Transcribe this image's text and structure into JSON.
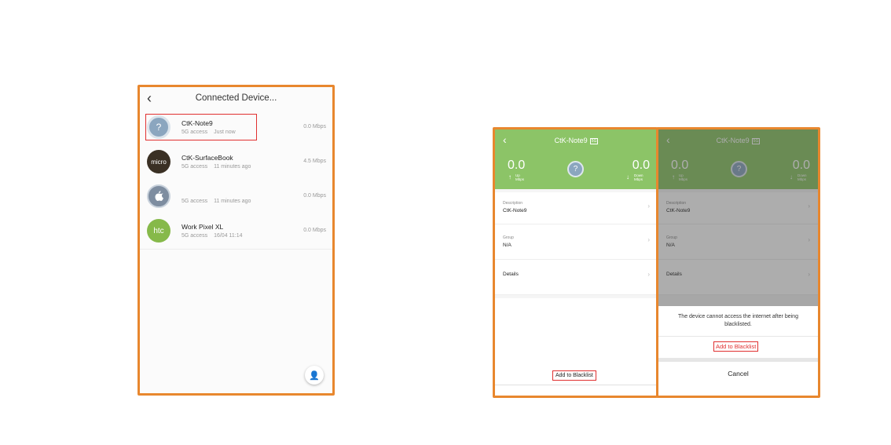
{
  "colors": {
    "frame": "#e8872e",
    "highlight": "#e03030",
    "header_green": "#8cc467"
  },
  "screen1": {
    "title": "Connected Device...",
    "devices": [
      {
        "name": "CtK-Note9",
        "band": "5G access",
        "time": "Just now",
        "speed": "0.0 Mbps",
        "avatar_icon": "question-mark-icon",
        "avatar_text": "?"
      },
      {
        "name": "CtK-SurfaceBook",
        "band": "5G access",
        "time": "11 minutes ago",
        "speed": "4.5 Mbps",
        "avatar_icon": "microsoft-logo-icon",
        "avatar_text": "micro"
      },
      {
        "name": "",
        "band": "5G access",
        "time": "11 minutes ago",
        "speed": "0.0 Mbps",
        "avatar_icon": "apple-logo-icon",
        "avatar_text": ""
      },
      {
        "name": "Work Pixel XL",
        "band": "5G access",
        "time": "16/04 11:14",
        "speed": "0.0 Mbps",
        "avatar_icon": "htc-logo-icon",
        "avatar_text": "htc"
      }
    ]
  },
  "detail": {
    "title": "CtK-Note9",
    "band_tag": "5G",
    "up_value": "0.0",
    "up_unit": "Up",
    "up_unit2": "Mbps",
    "down_value": "0.0",
    "down_unit": "Down",
    "down_unit2": "Mbps",
    "description_label": "Description",
    "description_value": "CtK-Note9",
    "group_label": "Group",
    "group_value": "N/A",
    "details_label": "Details",
    "blacklist_button": "Add to Blacklist"
  },
  "sheet": {
    "message": "The device cannot access the internet after being blacklisted.",
    "add_label": "Add to Blacklist",
    "cancel_label": "Cancel"
  }
}
